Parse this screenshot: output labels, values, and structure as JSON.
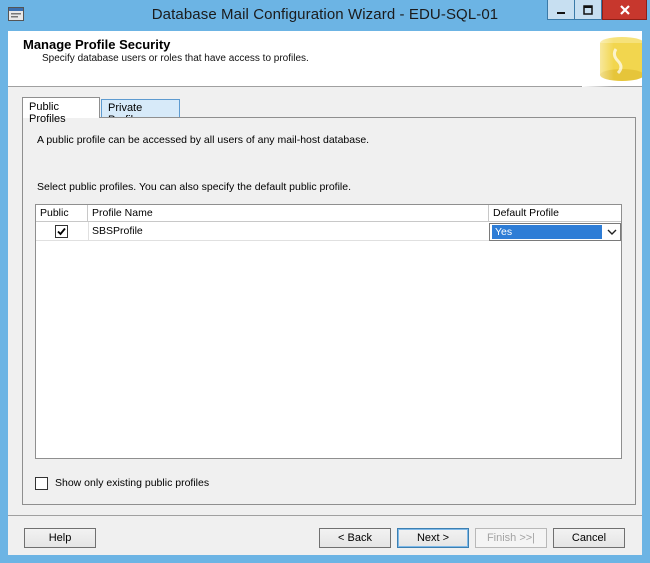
{
  "window": {
    "title": "Database Mail Configuration Wizard - EDU-SQL-01",
    "accent_color": "#6cb4e4",
    "close_color": "#c7372d"
  },
  "header": {
    "title": "Manage Profile Security",
    "subtitle": "Specify database users or roles that have access to profiles."
  },
  "tabs": [
    {
      "label": "Public Profiles",
      "selected": true
    },
    {
      "label": "Private Profiles",
      "selected": false
    }
  ],
  "panel": {
    "intro": "A public profile can be accessed by all users of any mail-host database.",
    "instruction": "Select public profiles. You can also specify the default public profile."
  },
  "grid": {
    "columns": [
      "Public",
      "Profile Name",
      "Default Profile"
    ],
    "rows": [
      {
        "public": true,
        "profile_name": "SBSProfile",
        "default_profile": "Yes"
      }
    ]
  },
  "show_only_existing": {
    "label": "Show only existing public profiles",
    "checked": false
  },
  "footer": {
    "help": "Help",
    "back": "< Back",
    "next": "Next >",
    "finish": "Finish >>|",
    "cancel": "Cancel"
  },
  "icons": {
    "app": "wizard-app-icon",
    "minimize": "minimize-icon",
    "maximize": "maximize-icon",
    "close": "close-icon",
    "header": "database-mail-icon",
    "checkbox": "checkmark-icon",
    "dropdown": "chevron-down-icon"
  }
}
